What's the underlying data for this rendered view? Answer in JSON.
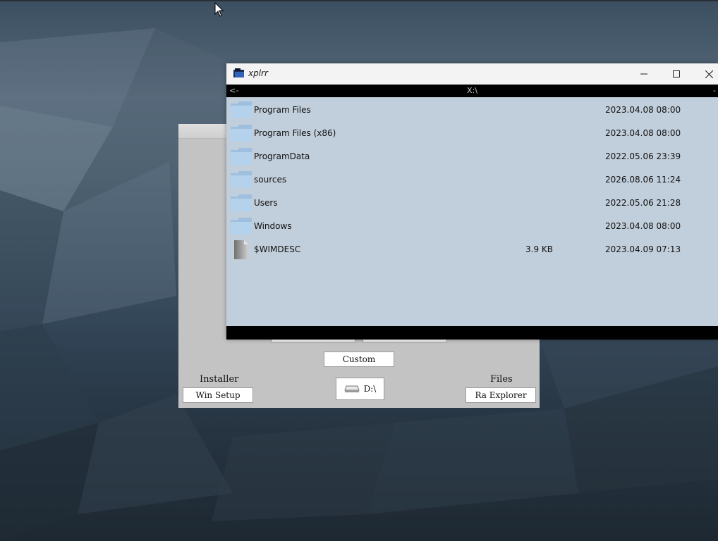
{
  "explorer": {
    "title": "xplrr",
    "path": "X:\\",
    "back_label": "<-",
    "menu_label": "-",
    "items": [
      {
        "name": "Program Files",
        "type": "folder",
        "size": "",
        "date": "2023.04.08 08:00"
      },
      {
        "name": "Program Files (x86)",
        "type": "folder",
        "size": "",
        "date": "2023.04.08 08:00"
      },
      {
        "name": "ProgramData",
        "type": "folder",
        "size": "",
        "date": "2022.05.06 23:39"
      },
      {
        "name": "sources",
        "type": "folder",
        "size": "",
        "date": "2026.08.06 11:24"
      },
      {
        "name": "Users",
        "type": "folder",
        "size": "",
        "date": "2022.05.06 21:28"
      },
      {
        "name": "Windows",
        "type": "folder",
        "size": "",
        "date": "2023.04.08 08:00"
      },
      {
        "name": "$WIMDESC",
        "type": "file",
        "size": "3.9 KB",
        "date": "2023.04.09 07:13"
      }
    ],
    "colors": {
      "list_bg": "#c1cedb",
      "bar_bg": "#000000",
      "folder": "#a9c8e3"
    }
  },
  "launcher": {
    "custom_label": "Custom",
    "installer_label": "Installer",
    "win_setup_label": "Win Setup",
    "drive_label": "D:\\",
    "files_label": "Files",
    "explorer_label": "Ra Explorer"
  },
  "icons": {
    "app": "folder-app-icon",
    "minimize": "minimize-icon",
    "maximize": "maximize-icon",
    "close": "close-icon",
    "folder": "folder-icon",
    "file": "file-icon",
    "drive": "drive-icon",
    "cursor": "mouse-cursor-icon"
  }
}
